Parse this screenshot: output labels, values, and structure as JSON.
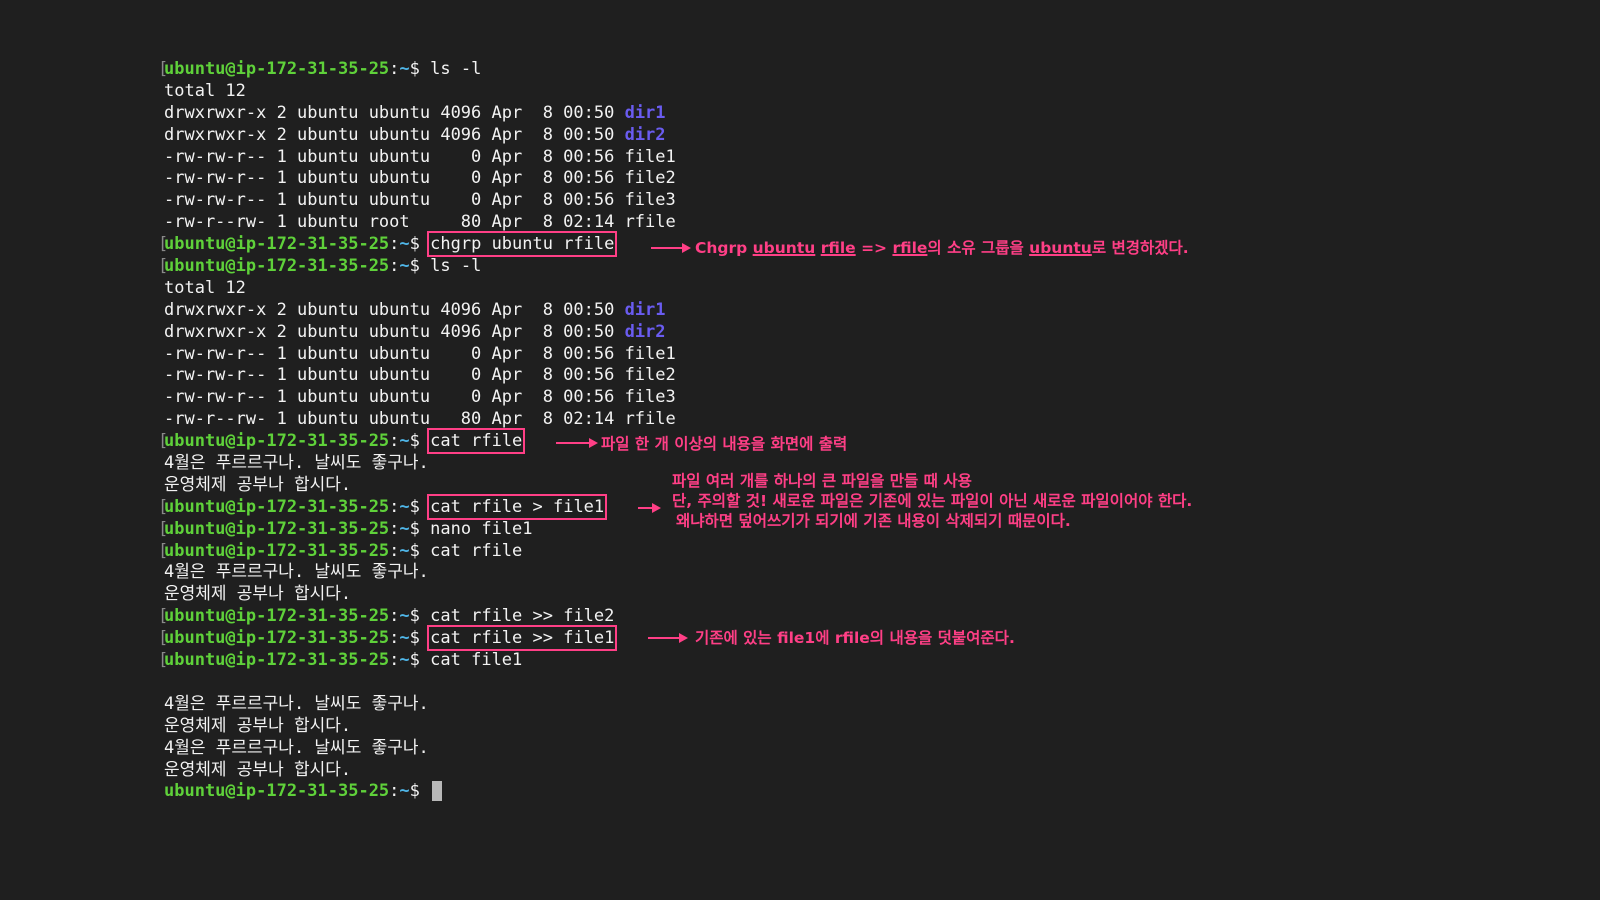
{
  "prompt": {
    "user_host": "ubuntu@ip-172-31-35-25",
    "colon": ":",
    "path": "~",
    "symbol": "$ ",
    "bracket": "["
  },
  "lines": [
    {
      "type": "prompt",
      "cmd": "ls -l"
    },
    {
      "type": "text",
      "text": "total 12"
    },
    {
      "type": "ls",
      "text": "drwxrwxr-x 2 ubuntu ubuntu 4096 Apr  8 00:50 ",
      "dir": "dir1"
    },
    {
      "type": "ls",
      "text": "drwxrwxr-x 2 ubuntu ubuntu 4096 Apr  8 00:50 ",
      "dir": "dir2"
    },
    {
      "type": "text",
      "text": "-rw-rw-r-- 1 ubuntu ubuntu    0 Apr  8 00:56 file1"
    },
    {
      "type": "text",
      "text": "-rw-rw-r-- 1 ubuntu ubuntu    0 Apr  8 00:56 file2"
    },
    {
      "type": "text",
      "text": "-rw-rw-r-- 1 ubuntu ubuntu    0 Apr  8 00:56 file3"
    },
    {
      "type": "text",
      "text": "-rw-r--rw- 1 ubuntu root     80 Apr  8 02:14 rfile"
    },
    {
      "type": "prompt",
      "cmd": "chgrp ubuntu rfile",
      "boxed": true
    },
    {
      "type": "prompt",
      "cmd": "ls -l"
    },
    {
      "type": "text",
      "text": "total 12"
    },
    {
      "type": "ls",
      "text": "drwxrwxr-x 2 ubuntu ubuntu 4096 Apr  8 00:50 ",
      "dir": "dir1"
    },
    {
      "type": "ls",
      "text": "drwxrwxr-x 2 ubuntu ubuntu 4096 Apr  8 00:50 ",
      "dir": "dir2"
    },
    {
      "type": "text",
      "text": "-rw-rw-r-- 1 ubuntu ubuntu    0 Apr  8 00:56 file1"
    },
    {
      "type": "text",
      "text": "-rw-rw-r-- 1 ubuntu ubuntu    0 Apr  8 00:56 file2"
    },
    {
      "type": "text",
      "text": "-rw-rw-r-- 1 ubuntu ubuntu    0 Apr  8 00:56 file3"
    },
    {
      "type": "text",
      "text": "-rw-r--rw- 1 ubuntu ubuntu   80 Apr  8 02:14 rfile"
    },
    {
      "type": "prompt",
      "cmd": "cat rfile",
      "boxed": true
    },
    {
      "type": "text",
      "text": "4월은 푸르르구나. 날씨도 좋구나."
    },
    {
      "type": "text",
      "text": "운영체제 공부나 합시다."
    },
    {
      "type": "prompt",
      "cmd": "cat rfile > file1",
      "boxed": true
    },
    {
      "type": "prompt",
      "cmd": "nano file1"
    },
    {
      "type": "prompt",
      "cmd": "cat rfile"
    },
    {
      "type": "text",
      "text": "4월은 푸르르구나. 날씨도 좋구나."
    },
    {
      "type": "text",
      "text": "운영체제 공부나 합시다."
    },
    {
      "type": "prompt",
      "cmd": "cat rfile >> file2"
    },
    {
      "type": "prompt",
      "cmd": "cat rfile >> file1",
      "boxed": true
    },
    {
      "type": "prompt",
      "cmd": "cat file1"
    },
    {
      "type": "text",
      "text": ""
    },
    {
      "type": "text",
      "text": "4월은 푸르르구나. 날씨도 좋구나."
    },
    {
      "type": "text",
      "text": "운영체제 공부나 합시다."
    },
    {
      "type": "text",
      "text": "4월은 푸르르구나. 날씨도 좋구나."
    },
    {
      "type": "text",
      "text": "운영체제 공부나 합시다."
    },
    {
      "type": "prompt_final",
      "cmd": ""
    }
  ],
  "annotations": {
    "chgrp": {
      "a": "Chgrp ",
      "u1": "ubuntu",
      "s1": " ",
      "u2": "rfile",
      "s2": " => ",
      "u3": "rfile",
      "s3": "의 소유 그룹을 ",
      "u4": "ubuntu",
      "s4": "로 변경하겠다."
    },
    "cat": "파일 한 개 이상의 내용을 화면에 출력",
    "redirect": [
      "파일 여러 개를 하나의 큰 파일을 만들 때 사용",
      "단, 주의할 것! 새로운 파일은 기존에 있는 파일이 아닌 새로운 파일이어야 한다.",
      "왜냐하면 덮어쓰기가 되기에 기존 내용이 삭제되기 때문이다."
    ],
    "append": "기존에 있는 file1에 rfile의 내용을 덧붙여준다."
  },
  "colors": {
    "background": "#1f1f1f",
    "user_host": "#5fd13a",
    "path": "#4fb6e8",
    "directory": "#6a5cf0",
    "annotation": "#ff3f86"
  }
}
